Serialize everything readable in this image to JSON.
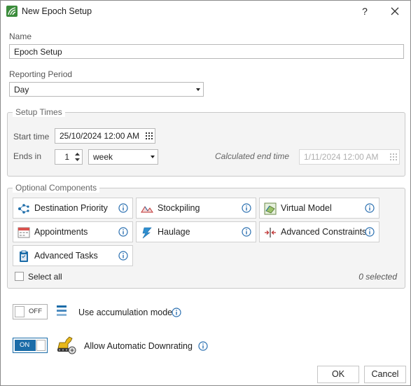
{
  "window": {
    "title": "New Epoch Setup",
    "help_label": "?"
  },
  "name_field": {
    "label": "Name",
    "value": "Epoch Setup"
  },
  "reporting_period": {
    "label": "Reporting Period",
    "value": "Day"
  },
  "setup_times": {
    "legend": "Setup Times",
    "start_label": "Start time",
    "start_value": "25/10/2024 12:00 AM",
    "ends_label": "Ends in",
    "ends_count": "1",
    "ends_unit": "week",
    "calc_label": "Calculated end time",
    "calc_value": "1/11/2024 12:00 AM"
  },
  "optional_components": {
    "legend": "Optional Components",
    "items": [
      {
        "label": "Destination Priority",
        "icon": "destination-priority-icon"
      },
      {
        "label": "Stockpiling",
        "icon": "stockpiling-icon"
      },
      {
        "label": "Virtual Model",
        "icon": "virtual-model-icon"
      },
      {
        "label": "Appointments",
        "icon": "appointments-icon"
      },
      {
        "label": "Haulage",
        "icon": "haulage-icon"
      },
      {
        "label": "Advanced Constraints",
        "icon": "advanced-constraints-icon"
      },
      {
        "label": "Advanced Tasks",
        "icon": "advanced-tasks-icon"
      }
    ],
    "select_all_label": "Select all",
    "selected_count": "0 selected"
  },
  "accumulation": {
    "toggle_label": "OFF",
    "label": "Use accumulation mode",
    "state": "off"
  },
  "downrating": {
    "toggle_label": "ON",
    "label": "Allow Automatic Downrating",
    "state": "on"
  },
  "buttons": {
    "ok": "OK",
    "cancel": "Cancel"
  },
  "colors": {
    "accent": "#1b6ca8",
    "info": "#2a6fb0",
    "brand": "#3b8c3b"
  }
}
